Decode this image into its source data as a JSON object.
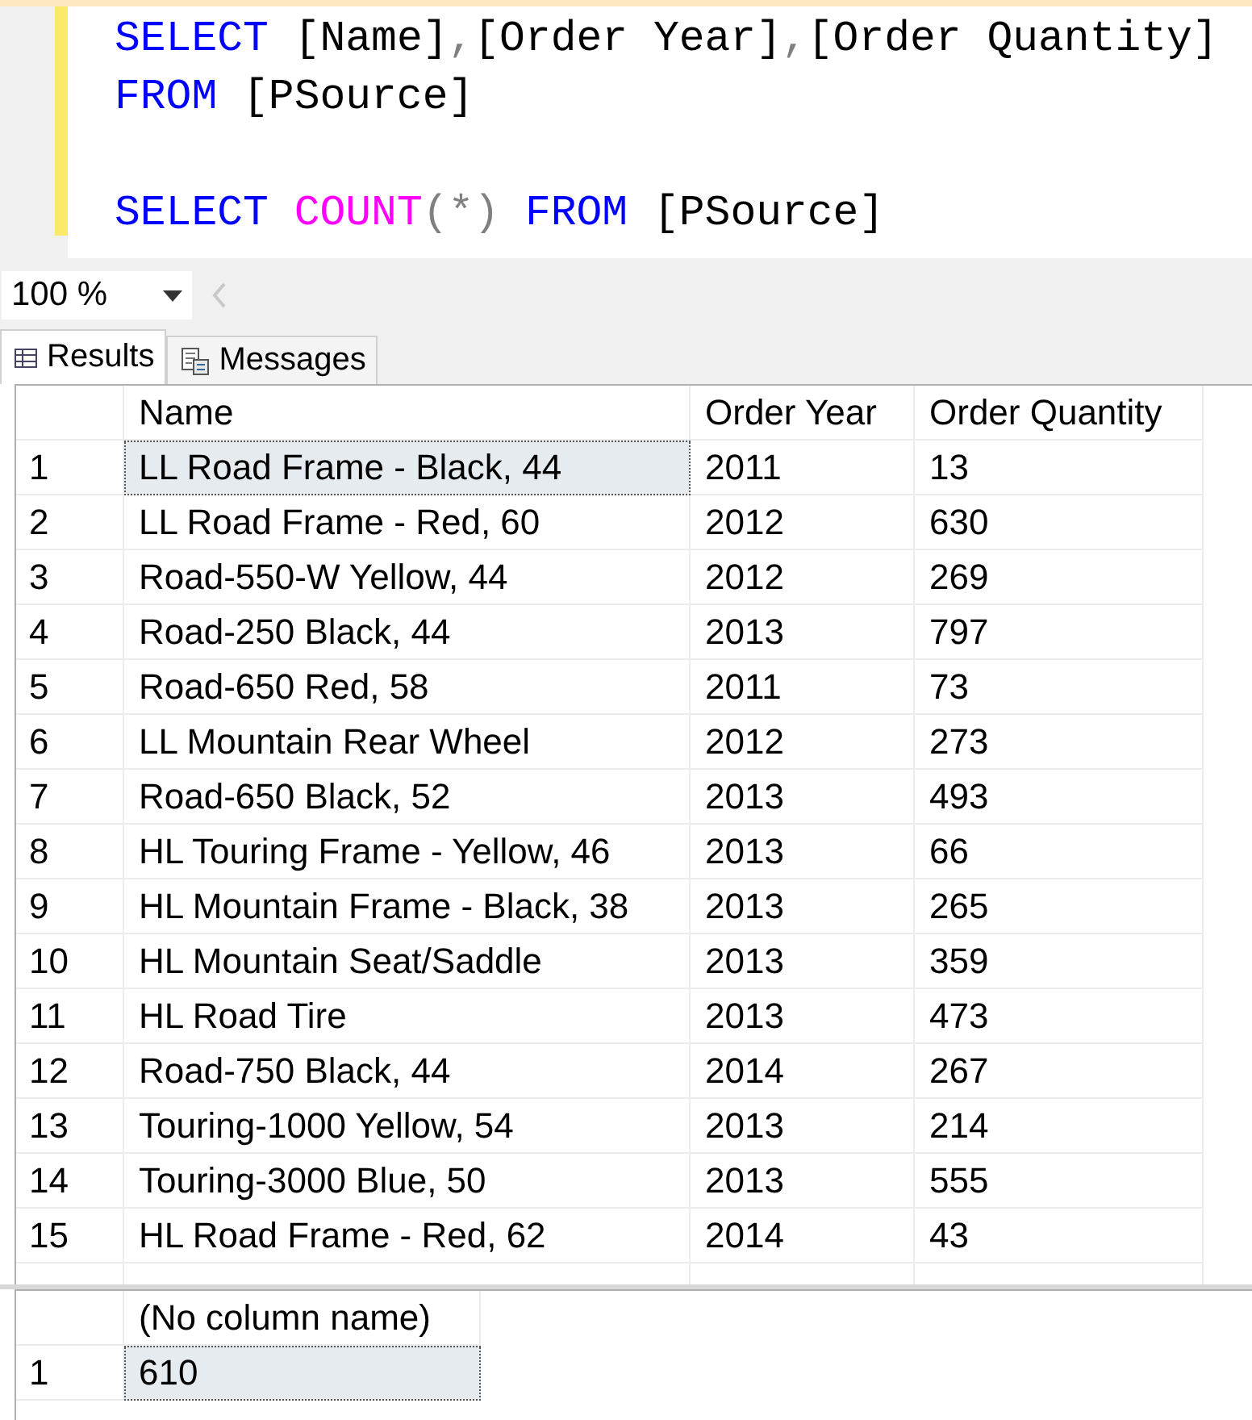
{
  "editor": {
    "lines": [
      {
        "gap_before": false,
        "tokens": [
          {
            "kind": "keyword",
            "text": "SELECT "
          },
          {
            "kind": "ident",
            "text": "[Name]"
          },
          {
            "kind": "punct",
            "text": ","
          },
          {
            "kind": "ident",
            "text": "[Order Year]"
          },
          {
            "kind": "punct",
            "text": ","
          },
          {
            "kind": "ident",
            "text": "[Order Quantity]"
          }
        ]
      },
      {
        "gap_before": false,
        "tokens": [
          {
            "kind": "keyword",
            "text": "FROM "
          },
          {
            "kind": "ident",
            "text": "[PSource]"
          }
        ]
      },
      {
        "gap_before": true,
        "tokens": [
          {
            "kind": "keyword",
            "text": "SELECT "
          },
          {
            "kind": "function",
            "text": "COUNT"
          },
          {
            "kind": "punct",
            "text": "(*) "
          },
          {
            "kind": "keyword",
            "text": "FROM "
          },
          {
            "kind": "ident",
            "text": "[PSource]"
          }
        ]
      }
    ]
  },
  "zoom": {
    "value": "100 %"
  },
  "tabs": [
    {
      "label": "Results",
      "selected": true,
      "kind": "grid"
    },
    {
      "label": "Messages",
      "selected": false,
      "kind": "messages"
    }
  ],
  "grids": [
    {
      "columns": [
        "Name",
        "Order Year",
        "Order Quantity"
      ],
      "cut_row": true,
      "rows": [
        {
          "number": "1",
          "cells": [
            {
              "text": "LL Road Frame - Black, 44",
              "selected": true
            },
            {
              "text": "2011",
              "selected": false
            },
            {
              "text": "13",
              "selected": false
            }
          ]
        },
        {
          "number": "2",
          "cells": [
            {
              "text": "LL Road Frame - Red, 60",
              "selected": false
            },
            {
              "text": "2012",
              "selected": false
            },
            {
              "text": "630",
              "selected": false
            }
          ]
        },
        {
          "number": "3",
          "cells": [
            {
              "text": "Road-550-W Yellow, 44",
              "selected": false
            },
            {
              "text": "2012",
              "selected": false
            },
            {
              "text": "269",
              "selected": false
            }
          ]
        },
        {
          "number": "4",
          "cells": [
            {
              "text": "Road-250 Black, 44",
              "selected": false
            },
            {
              "text": "2013",
              "selected": false
            },
            {
              "text": "797",
              "selected": false
            }
          ]
        },
        {
          "number": "5",
          "cells": [
            {
              "text": "Road-650 Red, 58",
              "selected": false
            },
            {
              "text": "2011",
              "selected": false
            },
            {
              "text": "73",
              "selected": false
            }
          ]
        },
        {
          "number": "6",
          "cells": [
            {
              "text": "LL Mountain Rear Wheel",
              "selected": false
            },
            {
              "text": "2012",
              "selected": false
            },
            {
              "text": "273",
              "selected": false
            }
          ]
        },
        {
          "number": "7",
          "cells": [
            {
              "text": "Road-650 Black, 52",
              "selected": false
            },
            {
              "text": "2013",
              "selected": false
            },
            {
              "text": "493",
              "selected": false
            }
          ]
        },
        {
          "number": "8",
          "cells": [
            {
              "text": "HL Touring Frame - Yellow, 46",
              "selected": false
            },
            {
              "text": "2013",
              "selected": false
            },
            {
              "text": "66",
              "selected": false
            }
          ]
        },
        {
          "number": "9",
          "cells": [
            {
              "text": "HL Mountain Frame - Black, 38",
              "selected": false
            },
            {
              "text": "2013",
              "selected": false
            },
            {
              "text": "265",
              "selected": false
            }
          ]
        },
        {
          "number": "10",
          "cells": [
            {
              "text": "HL Mountain Seat/Saddle",
              "selected": false
            },
            {
              "text": "2013",
              "selected": false
            },
            {
              "text": "359",
              "selected": false
            }
          ]
        },
        {
          "number": "11",
          "cells": [
            {
              "text": "HL Road Tire",
              "selected": false
            },
            {
              "text": "2013",
              "selected": false
            },
            {
              "text": "473",
              "selected": false
            }
          ]
        },
        {
          "number": "12",
          "cells": [
            {
              "text": "Road-750 Black, 44",
              "selected": false
            },
            {
              "text": "2014",
              "selected": false
            },
            {
              "text": "267",
              "selected": false
            }
          ]
        },
        {
          "number": "13",
          "cells": [
            {
              "text": "Touring-1000 Yellow, 54",
              "selected": false
            },
            {
              "text": "2013",
              "selected": false
            },
            {
              "text": "214",
              "selected": false
            }
          ]
        },
        {
          "number": "14",
          "cells": [
            {
              "text": "Touring-3000 Blue, 50",
              "selected": false
            },
            {
              "text": "2013",
              "selected": false
            },
            {
              "text": "555",
              "selected": false
            }
          ]
        },
        {
          "number": "15",
          "cells": [
            {
              "text": "HL Road Frame - Red, 62",
              "selected": false
            },
            {
              "text": "2014",
              "selected": false
            },
            {
              "text": "43",
              "selected": false
            }
          ]
        }
      ]
    },
    {
      "columns": [
        "(No column name)"
      ],
      "cut_row": false,
      "rows": [
        {
          "number": "1",
          "cells": [
            {
              "text": "610",
              "selected": true
            }
          ]
        }
      ]
    }
  ]
}
